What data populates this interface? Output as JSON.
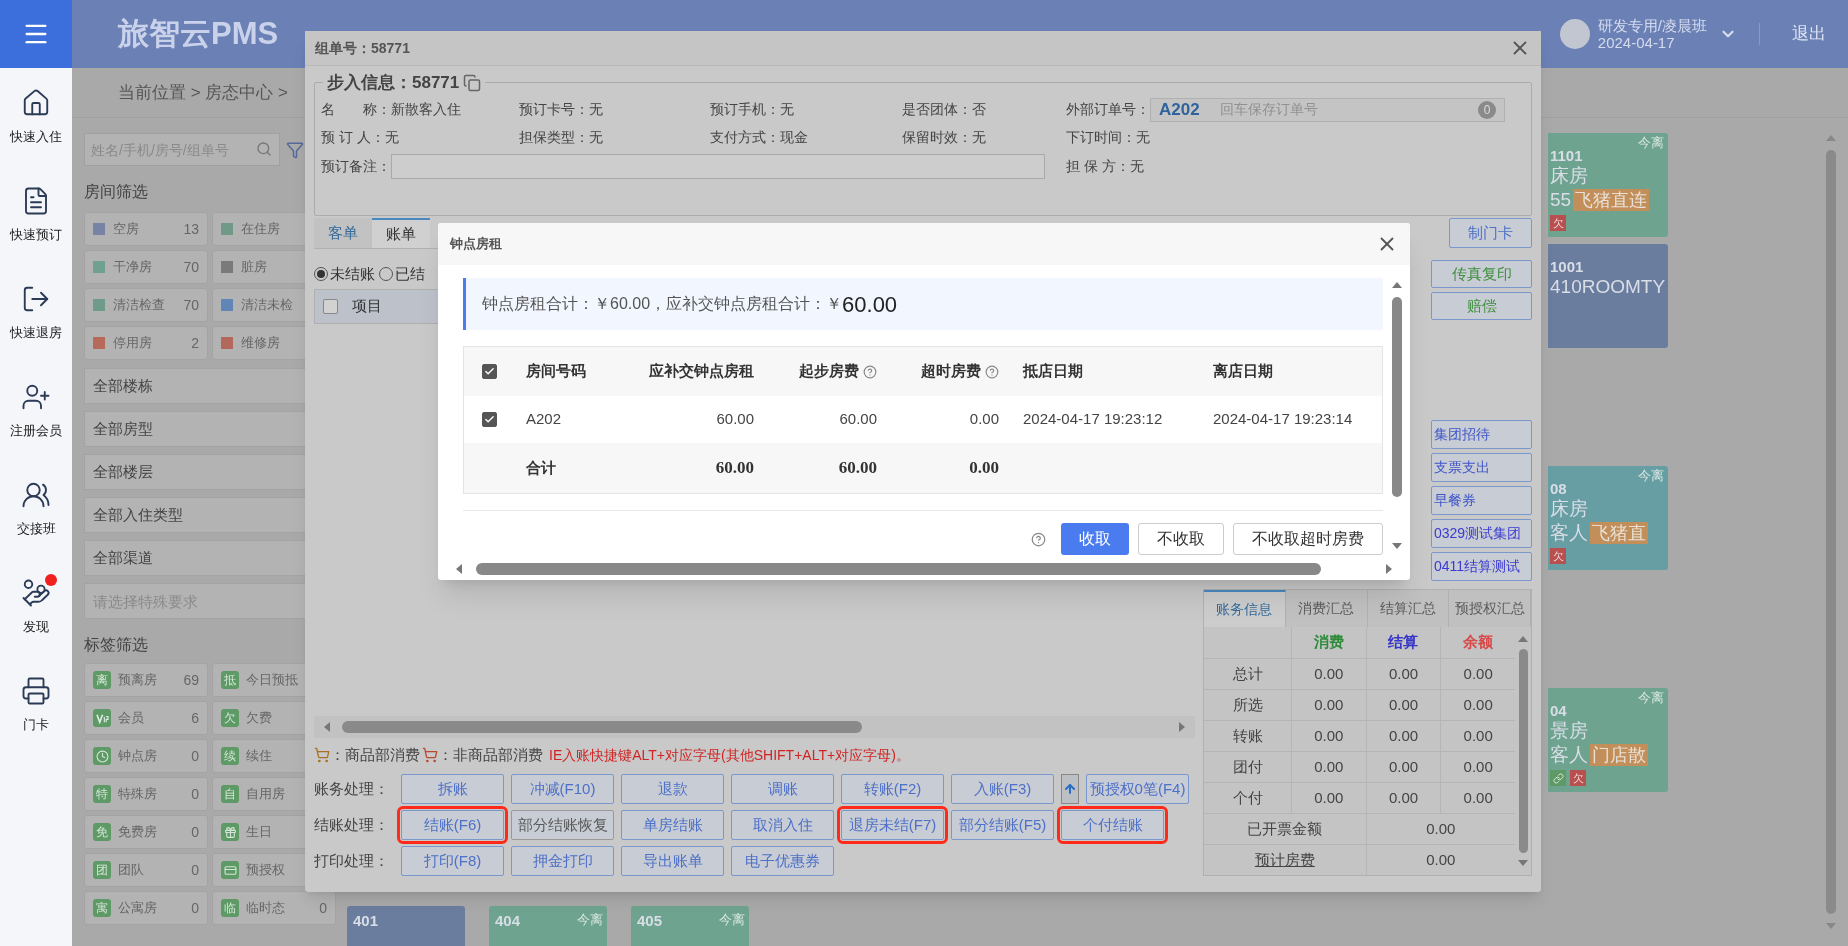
{
  "sidebar": {
    "items": [
      {
        "kind": "checkin",
        "label": "快速入住",
        "notification": false
      },
      {
        "kind": "booking",
        "label": "快速预订",
        "notification": false
      },
      {
        "kind": "checkout",
        "label": "快速退房",
        "notification": false
      },
      {
        "kind": "member",
        "label": "注册会员",
        "notification": false
      },
      {
        "kind": "handover",
        "label": "交接班",
        "notification": false
      },
      {
        "kind": "discover",
        "label": "发现",
        "notification": true
      },
      {
        "kind": "card",
        "label": "门卡",
        "notification": false
      }
    ]
  },
  "header": {
    "logo": "旅智云PMS",
    "user_name": "研发专用/凌晨班",
    "user_date": "2024-04-17",
    "logout": "退出"
  },
  "breadcrumb": "当前位置 > 房态中心 >",
  "filters": {
    "search_placeholder": "姓名/手机/房号/组单号",
    "room_title": "房间筛选",
    "room_status": [
      {
        "label": "空房",
        "count": "13",
        "color": "#7683a6"
      },
      {
        "label": "在住房",
        "color": "#6f9a88"
      },
      {
        "label": "干净房",
        "count": "70",
        "color": "#6fa090"
      },
      {
        "label": "脏房",
        "color": "#7a7a7a"
      },
      {
        "label": "清洁检查",
        "count": "70",
        "color": "#6f9c8a"
      },
      {
        "label": "清洁未检",
        "color": "#5f86b6"
      },
      {
        "label": "停用房",
        "count": "2",
        "color": "#b86a5a"
      },
      {
        "label": "维修房",
        "color": "#b2695c"
      }
    ],
    "selects": [
      "全部楼栋",
      "全部房型",
      "全部楼层",
      "全部入住类型",
      "全部渠道"
    ],
    "special_placeholder": "请选择特殊要求",
    "tag_title": "标签筛选",
    "tags": [
      {
        "kind": "glyph",
        "glyph": "离",
        "label": "预离房",
        "count": "69"
      },
      {
        "kind": "glyph",
        "glyph": "抵",
        "label": "今日预抵"
      },
      {
        "kind": "vip",
        "label": "会员",
        "count": "6"
      },
      {
        "kind": "glyph",
        "glyph": "欠",
        "label": "欠费"
      },
      {
        "kind": "clock",
        "label": "钟点房",
        "count": "0"
      },
      {
        "kind": "glyph",
        "glyph": "续",
        "label": "续住"
      },
      {
        "kind": "glyph",
        "glyph": "特",
        "label": "特殊房",
        "count": "0"
      },
      {
        "kind": "glyph",
        "glyph": "自",
        "label": "自用房"
      },
      {
        "kind": "glyph",
        "glyph": "免",
        "label": "免费房",
        "count": "0"
      },
      {
        "kind": "gift",
        "label": "生日"
      },
      {
        "kind": "glyph",
        "glyph": "团",
        "label": "团队",
        "count": "0"
      },
      {
        "kind": "card",
        "label": "预授权"
      },
      {
        "kind": "glyph",
        "glyph": "寓",
        "label": "公寓房",
        "count": "0"
      },
      {
        "kind": "glyph",
        "glyph": "临",
        "label": "临时态",
        "count": "0"
      }
    ]
  },
  "room_tiles": [
    {
      "number": "1101",
      "type_text": "床房",
      "guest_text": "55",
      "tag": "飞猪直连",
      "badge": "欠",
      "link": false,
      "status": "今离",
      "color": "#6ea48f"
    },
    {
      "number": "1001",
      "type_text": "410ROOMTY",
      "color": "#6b7d9f"
    },
    {
      "number": "08",
      "type_text": "床房",
      "guest_text": "客人",
      "tag": "飞猪直",
      "badge": "欠",
      "link": false,
      "status": "今离",
      "color": "#669ea4"
    },
    {
      "number": "04",
      "type_text": "景房",
      "guest_text": "客人",
      "tag": "门店散",
      "badge": "欠",
      "link": true,
      "status": "今离",
      "color": "#6ea48f"
    }
  ],
  "bottom_tiles": [
    {
      "number": "401",
      "color": "#6b7d9f"
    },
    {
      "number": "404",
      "status": "今离",
      "color": "#6ea48f"
    },
    {
      "number": "405",
      "status": "今离",
      "color": "#6ea48f"
    }
  ],
  "modal": {
    "title": "组单号：58771",
    "legend": "步入信息：58771",
    "info_rows": [
      [
        {
          "label": "名　　称：",
          "value": "新散客入住"
        },
        {
          "label": "预订卡号：",
          "value": "无"
        },
        {
          "label": "预订手机：",
          "value": "无"
        },
        {
          "label": "是否团体：",
          "value": "否"
        },
        {
          "kind": "order",
          "label": "外部订单号：",
          "value": "A202",
          "placeholder": "回车保存订单号",
          "badge": "0"
        }
      ],
      [
        {
          "label": "预 订 人：",
          "value": "无"
        },
        {
          "label": "担保类型：",
          "value": "无"
        },
        {
          "label": "支付方式：",
          "value": "现金"
        },
        {
          "label": "保留时效：",
          "value": "无"
        },
        {
          "label": "下订时间：",
          "value": "无"
        }
      ]
    ],
    "remark_label": "预订备注：",
    "guarantor": {
      "label": "担 保 方：",
      "value": "无"
    },
    "tabs": [
      {
        "label": "客单",
        "selected": false
      },
      {
        "label": "账单",
        "selected": true
      }
    ],
    "radios": [
      {
        "label": "未结账",
        "selected": true
      },
      {
        "label": "已结",
        "selected": false
      }
    ],
    "table_header": {
      "checked": false,
      "column": "项目"
    },
    "hint": {
      "goods": "：商品部消费",
      "non_goods": "：非商品部消费",
      "shortcut": "IE入账快捷键ALT+对应字母(其他SHIFT+ALT+对应字母)。"
    },
    "action_rows": [
      {
        "label": "账务处理：",
        "buttons": [
          {
            "kind": "text",
            "label": "拆账",
            "highlighted": false,
            "disabled": false
          },
          {
            "kind": "text",
            "label": "冲减(F10)",
            "highlighted": false,
            "disabled": false
          },
          {
            "kind": "text",
            "label": "退款",
            "highlighted": false,
            "disabled": false
          },
          {
            "kind": "text",
            "label": "调账",
            "highlighted": false,
            "disabled": false
          },
          {
            "kind": "text",
            "label": "转账(F2)",
            "highlighted": false,
            "disabled": false
          },
          {
            "kind": "text",
            "label": "入账(F3)",
            "highlighted": false,
            "disabled": false
          },
          {
            "kind": "arrow"
          },
          {
            "kind": "text",
            "label": "预授权0笔(F4)",
            "highlighted": false,
            "disabled": false
          }
        ]
      },
      {
        "label": "结账处理：",
        "buttons": [
          {
            "kind": "text",
            "label": "结账(F6)",
            "highlighted": true,
            "disabled": false
          },
          {
            "kind": "text",
            "label": "部分结账恢复",
            "highlighted": false,
            "disabled": true
          },
          {
            "kind": "text",
            "label": "单房结账",
            "highlighted": false,
            "disabled": false
          },
          {
            "kind": "text",
            "label": "取消入住",
            "highlighted": false,
            "disabled": false
          },
          {
            "kind": "text",
            "label": "退房未结(F7)",
            "highlighted": true,
            "disabled": false
          },
          {
            "kind": "text",
            "label": "部分结账(F5)",
            "highlighted": false,
            "disabled": false
          },
          {
            "kind": "text",
            "label": "个付结账",
            "highlighted": true,
            "disabled": false
          }
        ]
      },
      {
        "label": "打印处理：",
        "buttons": [
          {
            "kind": "text",
            "label": "打印(F8)",
            "highlighted": false,
            "disabled": false
          },
          {
            "kind": "text",
            "label": "押金打印",
            "highlighted": false,
            "disabled": false
          },
          {
            "kind": "text",
            "label": "导出账单",
            "highlighted": false,
            "disabled": false
          },
          {
            "kind": "text",
            "label": "电子优惠券",
            "highlighted": false,
            "disabled": false
          }
        ]
      }
    ],
    "door_card": "制门卡",
    "side_buttons_a": [
      {
        "label": "传真复印",
        "color": "#3f8f3f"
      },
      {
        "label": "赔偿",
        "color": "#3f8f3f"
      }
    ],
    "side_buttons_b": [
      {
        "label": "集团招待",
        "color": "#3f55c8"
      },
      {
        "label": "支票支出",
        "color": "#3f55c8"
      },
      {
        "label": "早餐券",
        "color": "#3f55c8"
      },
      {
        "label": "0329测试集团",
        "color": "#3a3ad0"
      },
      {
        "label": "0411结算测试",
        "color": "#3a3ad0"
      }
    ],
    "account": {
      "tabs": [
        {
          "label": "账务信息",
          "selected": true
        },
        {
          "label": "消费汇总",
          "selected": false
        },
        {
          "label": "结算汇总",
          "selected": false
        },
        {
          "label": "预授权汇总",
          "selected": false
        }
      ],
      "columns": [
        {
          "label": "消费",
          "color": "#2e8b3a"
        },
        {
          "label": "结算",
          "color": "#3535c8"
        },
        {
          "label": "余额",
          "color": "#d84848"
        }
      ],
      "rows": [
        {
          "label": "总计",
          "values": [
            "0.00",
            "0.00",
            "0.00"
          ]
        },
        {
          "label": "所选",
          "values": [
            "0.00",
            "0.00",
            "0.00"
          ]
        },
        {
          "label": "转账",
          "values": [
            "0.00",
            "0.00",
            "0.00"
          ]
        },
        {
          "label": "团付",
          "values": [
            "0.00",
            "0.00",
            "0.00"
          ]
        },
        {
          "label": "个付",
          "values": [
            "0.00",
            "0.00",
            "0.00"
          ]
        }
      ],
      "summary": [
        {
          "label": "已开票金额",
          "value": "0.00",
          "link": false
        },
        {
          "label": "预计房费",
          "value": "0.00",
          "link": true
        }
      ]
    }
  },
  "dialog": {
    "title": "钟点房租",
    "summary": "钟点房租合计：￥60.00，应补交钟点房租合计：￥",
    "summary_amount": "60.00",
    "header_checked": true,
    "columns": [
      {
        "label": "房间号码",
        "help": false
      },
      {
        "label": "应补交钟点房租",
        "help": false
      },
      {
        "label": "起步房费",
        "help": true
      },
      {
        "label": "超时房费",
        "help": true
      },
      {
        "label": "抵店日期",
        "help": false
      },
      {
        "label": "离店日期",
        "help": false
      }
    ],
    "rows": [
      {
        "checked": true,
        "cells": [
          "A202",
          "60.00",
          "60.00",
          "0.00",
          "2024-04-17 19:23:12",
          "2024-04-17 19:23:14"
        ]
      }
    ],
    "total": {
      "label": "合计",
      "cells": [
        "60.00",
        "60.00",
        "0.00"
      ]
    },
    "buttons": [
      {
        "label": "收取",
        "primary": true
      },
      {
        "label": "不收取",
        "primary": false
      },
      {
        "label": "不收取超时房费",
        "primary": false
      }
    ]
  }
}
